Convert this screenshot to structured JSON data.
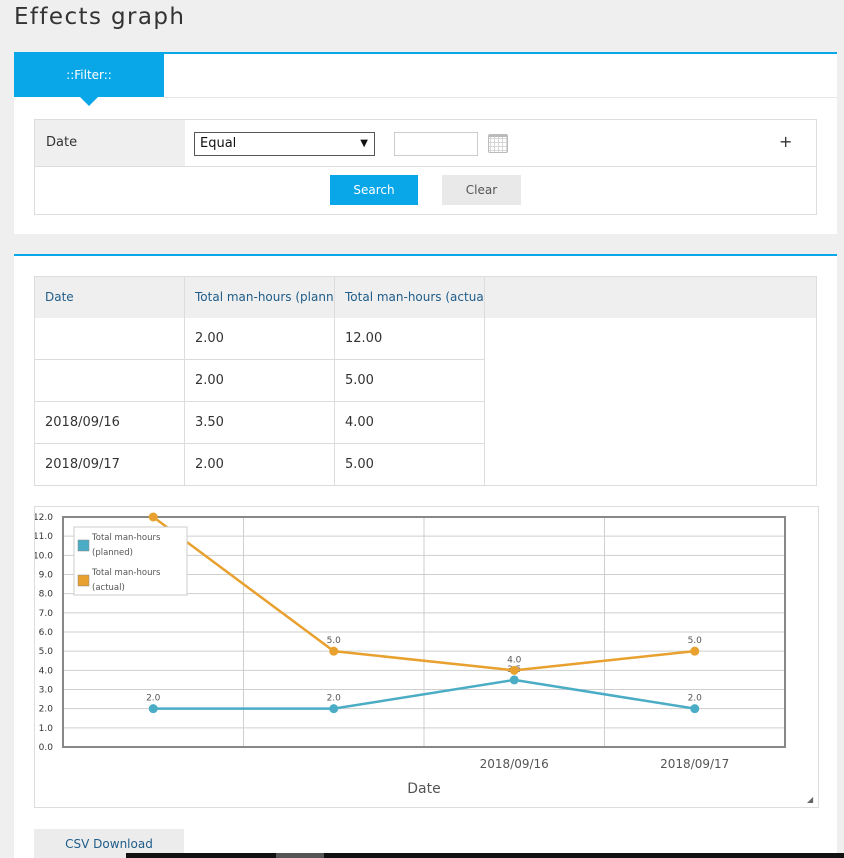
{
  "page": {
    "title": "Effects graph"
  },
  "filter": {
    "tab_label": "::Filter::",
    "field_label": "Date",
    "operator_value": "Equal",
    "date_value": "",
    "add_symbol": "+",
    "search_label": "Search",
    "clear_label": "Clear"
  },
  "table": {
    "headers": [
      "Date",
      "Total man-hours (planned)",
      "Total man-hours (actual)"
    ],
    "rows": [
      [
        "",
        "2.00",
        "12.00"
      ],
      [
        "",
        "2.00",
        "5.00"
      ],
      [
        "2018/09/16",
        "3.50",
        "4.00"
      ],
      [
        "2018/09/17",
        "2.00",
        "5.00"
      ]
    ]
  },
  "chart_data": {
    "type": "line",
    "categories": [
      "",
      "",
      "2018/09/16",
      "2018/09/17"
    ],
    "series": [
      {
        "name": "Total man-hours (planned)",
        "values": [
          2.0,
          2.0,
          3.5,
          2.0
        ],
        "labels": [
          "2.0",
          "2.0",
          "3.5",
          "2.0"
        ],
        "color": "#4bacc6"
      },
      {
        "name": "Total man-hours (actual)",
        "values": [
          12.0,
          5.0,
          4.0,
          5.0
        ],
        "labels": [
          "",
          "5.0",
          "4.0",
          "5.0"
        ],
        "color": "#e8a02f"
      }
    ],
    "xlabel": "Date",
    "ylabel": "",
    "ylim": [
      0,
      12
    ],
    "yticks": [
      "0.0",
      "1.0",
      "2.0",
      "3.0",
      "4.0",
      "5.0",
      "6.0",
      "7.0",
      "8.0",
      "9.0",
      "10.0",
      "11.0",
      "12.0"
    ],
    "grid": true,
    "legend": "top-left"
  },
  "actions": {
    "csv_label": "CSV Download"
  }
}
